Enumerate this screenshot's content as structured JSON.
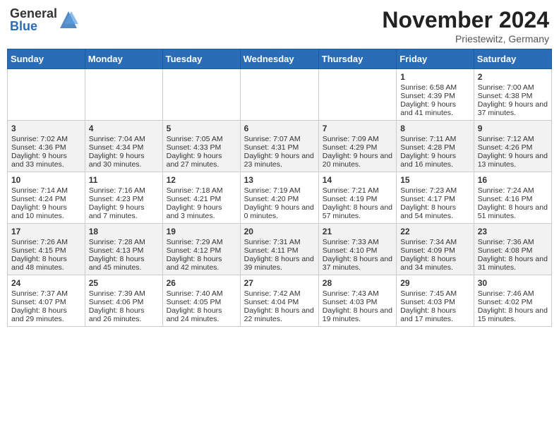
{
  "header": {
    "logo_general": "General",
    "logo_blue": "Blue",
    "month_title": "November 2024",
    "location": "Priestewitz, Germany"
  },
  "weekdays": [
    "Sunday",
    "Monday",
    "Tuesday",
    "Wednesday",
    "Thursday",
    "Friday",
    "Saturday"
  ],
  "weeks": [
    [
      {
        "day": "",
        "info": ""
      },
      {
        "day": "",
        "info": ""
      },
      {
        "day": "",
        "info": ""
      },
      {
        "day": "",
        "info": ""
      },
      {
        "day": "",
        "info": ""
      },
      {
        "day": "1",
        "info": "Sunrise: 6:58 AM\nSunset: 4:39 PM\nDaylight: 9 hours and 41 minutes."
      },
      {
        "day": "2",
        "info": "Sunrise: 7:00 AM\nSunset: 4:38 PM\nDaylight: 9 hours and 37 minutes."
      }
    ],
    [
      {
        "day": "3",
        "info": "Sunrise: 7:02 AM\nSunset: 4:36 PM\nDaylight: 9 hours and 33 minutes."
      },
      {
        "day": "4",
        "info": "Sunrise: 7:04 AM\nSunset: 4:34 PM\nDaylight: 9 hours and 30 minutes."
      },
      {
        "day": "5",
        "info": "Sunrise: 7:05 AM\nSunset: 4:33 PM\nDaylight: 9 hours and 27 minutes."
      },
      {
        "day": "6",
        "info": "Sunrise: 7:07 AM\nSunset: 4:31 PM\nDaylight: 9 hours and 23 minutes."
      },
      {
        "day": "7",
        "info": "Sunrise: 7:09 AM\nSunset: 4:29 PM\nDaylight: 9 hours and 20 minutes."
      },
      {
        "day": "8",
        "info": "Sunrise: 7:11 AM\nSunset: 4:28 PM\nDaylight: 9 hours and 16 minutes."
      },
      {
        "day": "9",
        "info": "Sunrise: 7:12 AM\nSunset: 4:26 PM\nDaylight: 9 hours and 13 minutes."
      }
    ],
    [
      {
        "day": "10",
        "info": "Sunrise: 7:14 AM\nSunset: 4:24 PM\nDaylight: 9 hours and 10 minutes."
      },
      {
        "day": "11",
        "info": "Sunrise: 7:16 AM\nSunset: 4:23 PM\nDaylight: 9 hours and 7 minutes."
      },
      {
        "day": "12",
        "info": "Sunrise: 7:18 AM\nSunset: 4:21 PM\nDaylight: 9 hours and 3 minutes."
      },
      {
        "day": "13",
        "info": "Sunrise: 7:19 AM\nSunset: 4:20 PM\nDaylight: 9 hours and 0 minutes."
      },
      {
        "day": "14",
        "info": "Sunrise: 7:21 AM\nSunset: 4:19 PM\nDaylight: 8 hours and 57 minutes."
      },
      {
        "day": "15",
        "info": "Sunrise: 7:23 AM\nSunset: 4:17 PM\nDaylight: 8 hours and 54 minutes."
      },
      {
        "day": "16",
        "info": "Sunrise: 7:24 AM\nSunset: 4:16 PM\nDaylight: 8 hours and 51 minutes."
      }
    ],
    [
      {
        "day": "17",
        "info": "Sunrise: 7:26 AM\nSunset: 4:15 PM\nDaylight: 8 hours and 48 minutes."
      },
      {
        "day": "18",
        "info": "Sunrise: 7:28 AM\nSunset: 4:13 PM\nDaylight: 8 hours and 45 minutes."
      },
      {
        "day": "19",
        "info": "Sunrise: 7:29 AM\nSunset: 4:12 PM\nDaylight: 8 hours and 42 minutes."
      },
      {
        "day": "20",
        "info": "Sunrise: 7:31 AM\nSunset: 4:11 PM\nDaylight: 8 hours and 39 minutes."
      },
      {
        "day": "21",
        "info": "Sunrise: 7:33 AM\nSunset: 4:10 PM\nDaylight: 8 hours and 37 minutes."
      },
      {
        "day": "22",
        "info": "Sunrise: 7:34 AM\nSunset: 4:09 PM\nDaylight: 8 hours and 34 minutes."
      },
      {
        "day": "23",
        "info": "Sunrise: 7:36 AM\nSunset: 4:08 PM\nDaylight: 8 hours and 31 minutes."
      }
    ],
    [
      {
        "day": "24",
        "info": "Sunrise: 7:37 AM\nSunset: 4:07 PM\nDaylight: 8 hours and 29 minutes."
      },
      {
        "day": "25",
        "info": "Sunrise: 7:39 AM\nSunset: 4:06 PM\nDaylight: 8 hours and 26 minutes."
      },
      {
        "day": "26",
        "info": "Sunrise: 7:40 AM\nSunset: 4:05 PM\nDaylight: 8 hours and 24 minutes."
      },
      {
        "day": "27",
        "info": "Sunrise: 7:42 AM\nSunset: 4:04 PM\nDaylight: 8 hours and 22 minutes."
      },
      {
        "day": "28",
        "info": "Sunrise: 7:43 AM\nSunset: 4:03 PM\nDaylight: 8 hours and 19 minutes."
      },
      {
        "day": "29",
        "info": "Sunrise: 7:45 AM\nSunset: 4:03 PM\nDaylight: 8 hours and 17 minutes."
      },
      {
        "day": "30",
        "info": "Sunrise: 7:46 AM\nSunset: 4:02 PM\nDaylight: 8 hours and 15 minutes."
      }
    ]
  ]
}
